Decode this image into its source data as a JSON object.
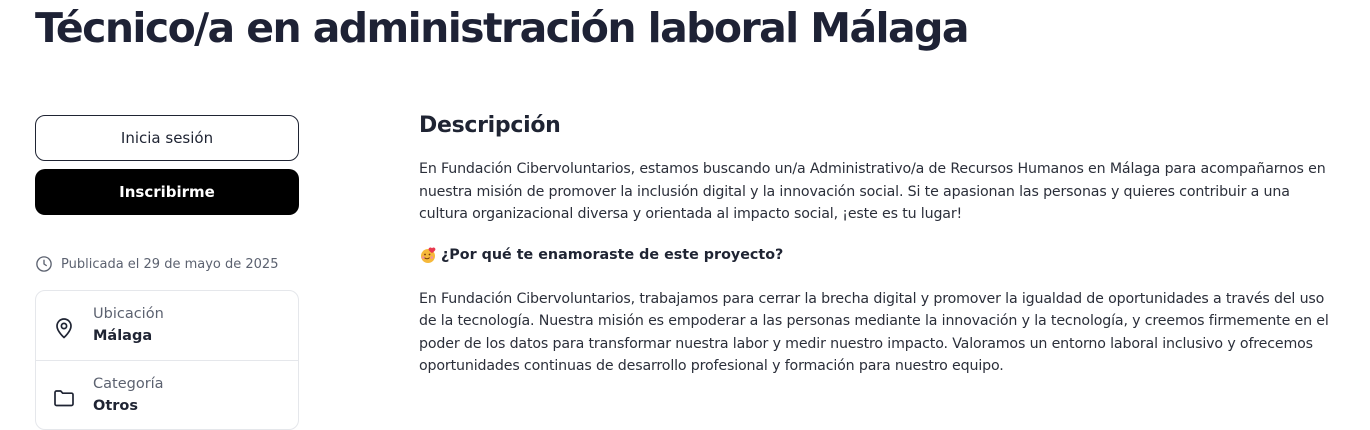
{
  "job": {
    "title": "Técnico/a en administración laboral Málaga"
  },
  "sidebar": {
    "login_label": "Inicia sesión",
    "signup_label": "Inscribirme",
    "published": "Publicada el 29 de mayo de 2025",
    "details": [
      {
        "icon": "location-pin-icon",
        "label": "Ubicación",
        "value": "Málaga"
      },
      {
        "icon": "folder-icon",
        "label": "Categoría",
        "value": "Otros"
      }
    ]
  },
  "description": {
    "heading": "Descripción",
    "intro": "En Fundación Cibervoluntarios, estamos buscando un/a Administrativo/a de Recursos Humanos en Málaga para acompañarnos en nuestra misión de promover la inclusión digital y la innovación social. Si te apasionan las personas y quieres contribuir a una cultura organizacional diversa y orientada al impacto social, ¡este es tu lugar!",
    "why_heading": "¿Por qué te enamoraste de este proyecto?",
    "why_icon": "heart-face-emoji-icon",
    "why_text": "En Fundación Cibervoluntarios, trabajamos para cerrar la brecha digital y promover la igualdad de oportunidades a través del uso de la tecnología. Nuestra misión es empoderar a las personas mediante la innovación y la tecnología, y creemos firmemente en el poder de los datos para transformar nuestra labor y medir nuestro impacto. Valoramos un entorno laboral inclusivo y ofrecemos oportunidades continuas de desarrollo profesional y formación para nuestro equipo."
  }
}
